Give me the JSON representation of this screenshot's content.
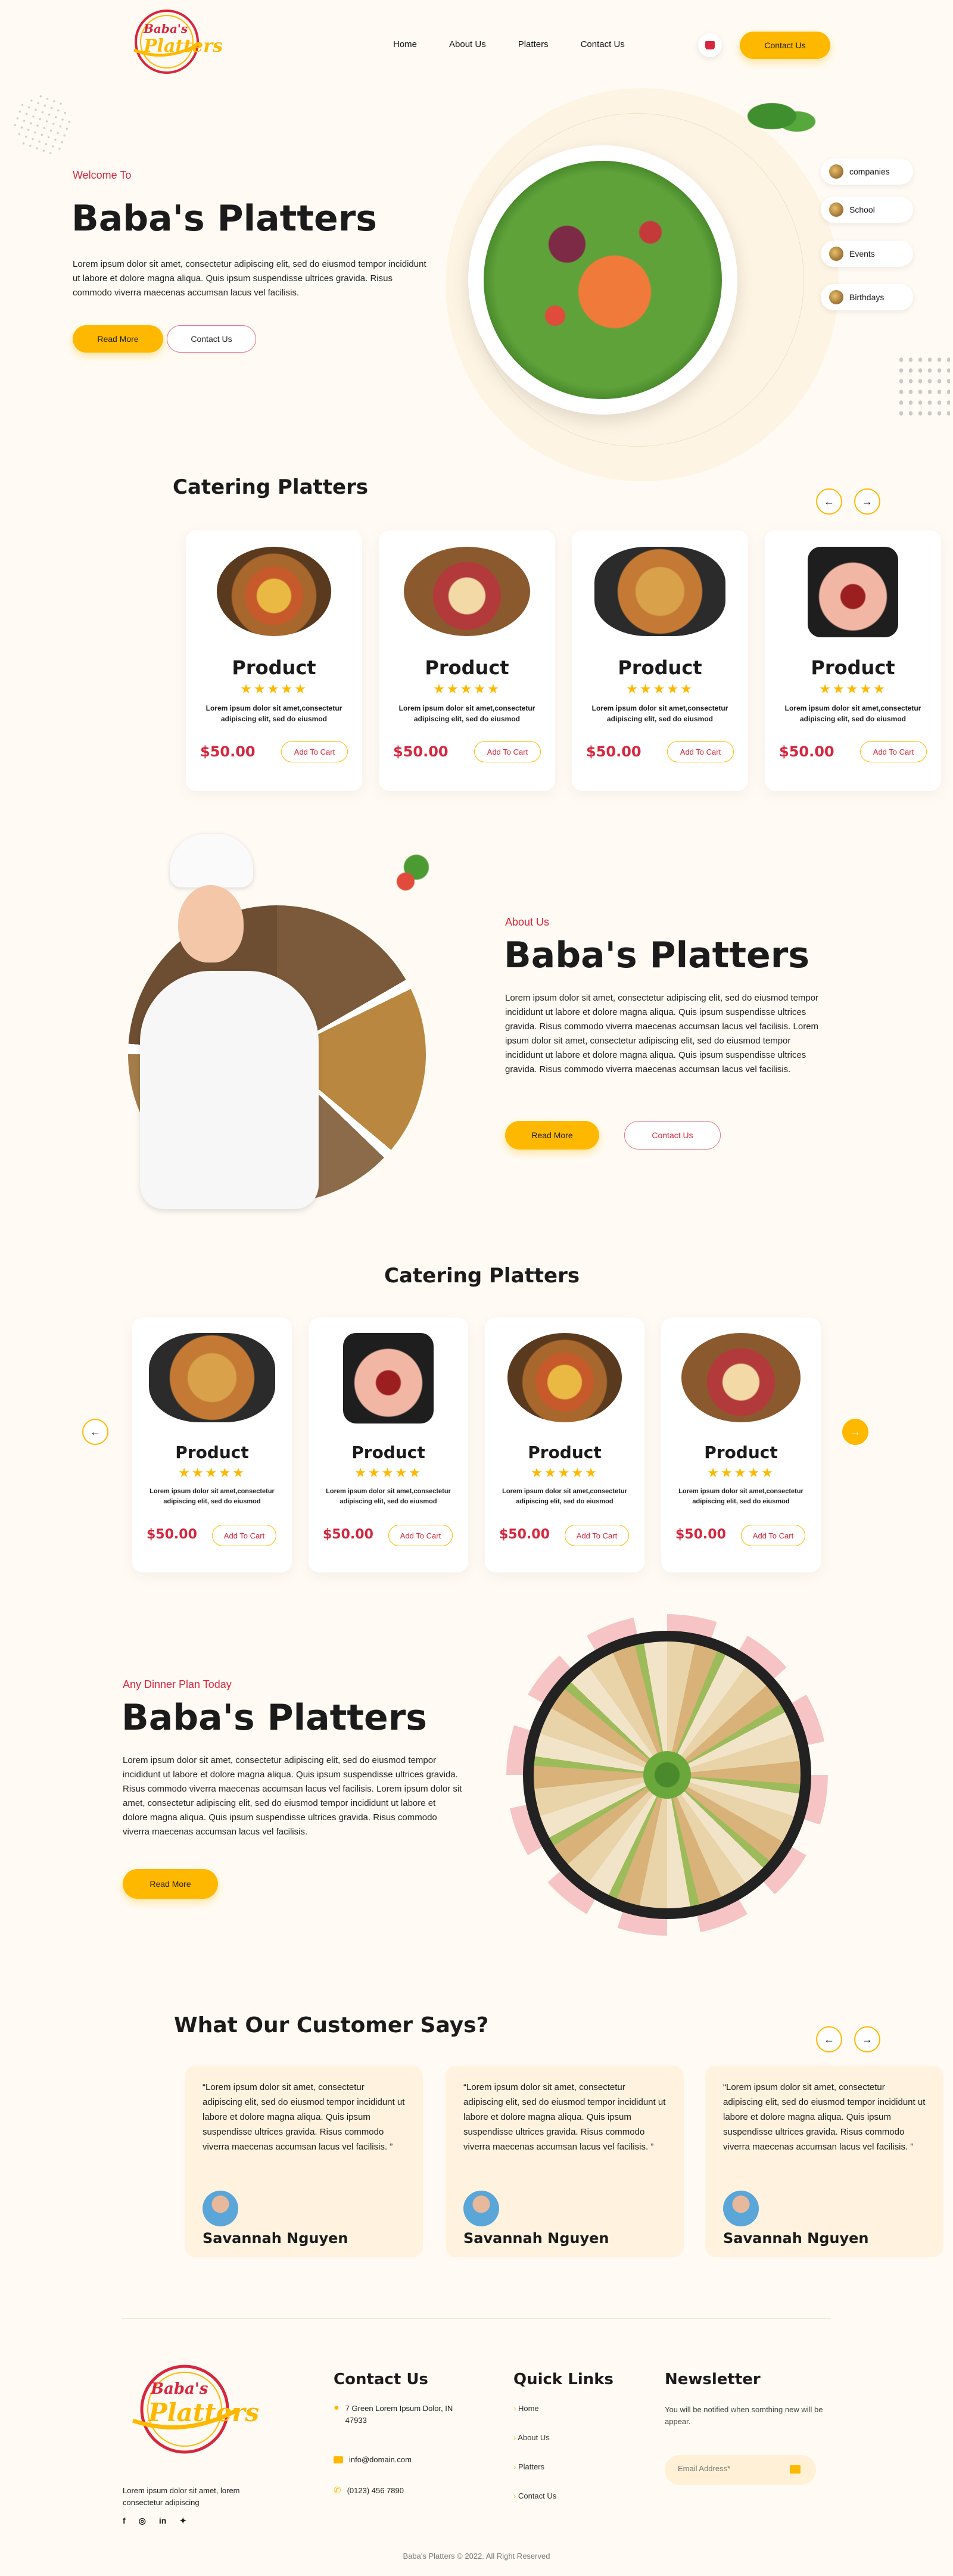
{
  "brand": {
    "logo_text": "Baba's Platters",
    "logo_small": "Baba's",
    "logo_big": "Platters"
  },
  "nav": {
    "items": [
      "Home",
      "About Us",
      "Platters",
      "Contact Us"
    ],
    "cta": "Contact Us"
  },
  "hero": {
    "kicker": "Welcome To",
    "title": "Baba's Platters",
    "text": "Lorem ipsum dolor sit amet, consectetur adipiscing elit, sed do eiusmod tempor incididunt ut labore et dolore magna aliqua. Quis ipsum suspendisse ultrices gravida. Risus commodo viverra maecenas accumsan lacus vel facilisis.",
    "btn_primary": "Read More",
    "btn_secondary": "Contact Us",
    "pills": [
      "companies",
      "School",
      "Events",
      "Birthdays"
    ]
  },
  "catering1": {
    "title": "Catering Platters",
    "products": [
      {
        "name": "Product",
        "stars": "★★★★★",
        "desc": "Lorem ipsum dolor sit amet,consectetur adipiscing elit, sed do eiusmod",
        "price": "$50.00",
        "cart": "Add To Cart"
      },
      {
        "name": "Product",
        "stars": "★★★★★",
        "desc": "Lorem ipsum dolor sit amet,consectetur adipiscing elit, sed do eiusmod",
        "price": "$50.00",
        "cart": "Add To Cart"
      },
      {
        "name": "Product",
        "stars": "★★★★★",
        "desc": "Lorem ipsum dolor sit amet,consectetur adipiscing elit, sed do eiusmod",
        "price": "$50.00",
        "cart": "Add To Cart"
      },
      {
        "name": "Product",
        "stars": "★★★★★",
        "desc": "Lorem ipsum dolor sit amet,consectetur adipiscing elit, sed do eiusmod",
        "price": "$50.00",
        "cart": "Add To Cart"
      }
    ]
  },
  "about": {
    "kicker": "About Us",
    "title": "Baba's Platters",
    "text": "Lorem ipsum dolor sit amet, consectetur adipiscing elit, sed do eiusmod tempor incididunt ut labore et dolore magna aliqua. Quis ipsum suspendisse ultrices gravida. Risus commodo viverra maecenas accumsan lacus vel facilisis. Lorem ipsum dolor sit amet, consectetur adipiscing elit, sed do eiusmod tempor incididunt ut labore et dolore magna aliqua. Quis ipsum suspendisse ultrices gravida. Risus commodo viverra maecenas accumsan lacus vel facilisis.",
    "btn_primary": "Read More",
    "btn_secondary": "Contact Us"
  },
  "catering2": {
    "title": "Catering Platters",
    "products": [
      {
        "name": "Product",
        "stars": "★★★★★",
        "desc": "Lorem ipsum dolor sit amet,consectetur adipiscing elit, sed do eiusmod",
        "price": "$50.00",
        "cart": "Add To Cart"
      },
      {
        "name": "Product",
        "stars": "★★★★★",
        "desc": "Lorem ipsum dolor sit amet,consectetur adipiscing elit, sed do eiusmod",
        "price": "$50.00",
        "cart": "Add To Cart"
      },
      {
        "name": "Product",
        "stars": "★★★★★",
        "desc": "Lorem ipsum dolor sit amet,consectetur adipiscing elit, sed do eiusmod",
        "price": "$50.00",
        "cart": "Add To Cart"
      },
      {
        "name": "Product",
        "stars": "★★★★★",
        "desc": "Lorem ipsum dolor sit amet,consectetur adipiscing elit, sed do eiusmod",
        "price": "$50.00",
        "cart": "Add To Cart"
      }
    ]
  },
  "dinner": {
    "kicker": "Any Dinner Plan Today",
    "title": "Baba's Platters",
    "text": "Lorem ipsum dolor sit amet, consectetur adipiscing elit, sed do eiusmod tempor incididunt ut labore et dolore magna aliqua. Quis ipsum suspendisse ultrices gravida. Risus commodo viverra maecenas accumsan lacus vel facilisis. Lorem ipsum dolor sit amet, consectetur adipiscing elit, sed do eiusmod tempor incididunt ut labore et dolore magna aliqua. Quis ipsum suspendisse ultrices gravida. Risus commodo viverra maecenas accumsan lacus vel facilisis.",
    "btn": "Read More"
  },
  "testimonials": {
    "title": "What Our Customer Says?",
    "items": [
      {
        "quote": "“Lorem ipsum dolor sit amet, consectetur adipiscing elit, sed do eiusmod tempor incididunt ut labore et dolore magna aliqua. Quis ipsum suspendisse ultrices gravida. Risus commodo viverra maecenas accumsan lacus vel facilisis. ”",
        "name": "Savannah Nguyen"
      },
      {
        "quote": "“Lorem ipsum dolor sit amet, consectetur adipiscing elit, sed do eiusmod tempor incididunt ut labore et dolore magna aliqua. Quis ipsum suspendisse ultrices gravida. Risus commodo viverra maecenas accumsan lacus vel facilisis. ”",
        "name": "Savannah Nguyen"
      },
      {
        "quote": "“Lorem ipsum dolor sit amet, consectetur adipiscing elit, sed do eiusmod tempor incididunt ut labore et dolore magna aliqua. Quis ipsum suspendisse ultrices gravida. Risus commodo viverra maecenas accumsan lacus vel facilisis. ”",
        "name": "Savannah Nguyen"
      }
    ]
  },
  "footer": {
    "about": "Lorem ipsum dolor sit amet, lorem consectetur adipiscing",
    "contact_title": "Contact Us",
    "address": "7 Green Lorem Ipsum Dolor, IN 47933",
    "email": "info@domain.com",
    "phone": "(0123) 456 7890",
    "links_title": "Quick Links",
    "links": [
      "Home",
      "About Us",
      "Platters",
      "Contact Us"
    ],
    "newsletter_title": "Newsletter",
    "newsletter_text": "You will be notified when somthing new will be appear.",
    "email_placeholder": "Email Address*",
    "social": [
      "f",
      "◎",
      "in",
      "✦"
    ],
    "copyright": "Baba's Platters © 2022. All Right Reserved"
  },
  "colors": {
    "accent": "#FFB800",
    "red": "#D7263D",
    "bg": "#FFFBF4"
  }
}
